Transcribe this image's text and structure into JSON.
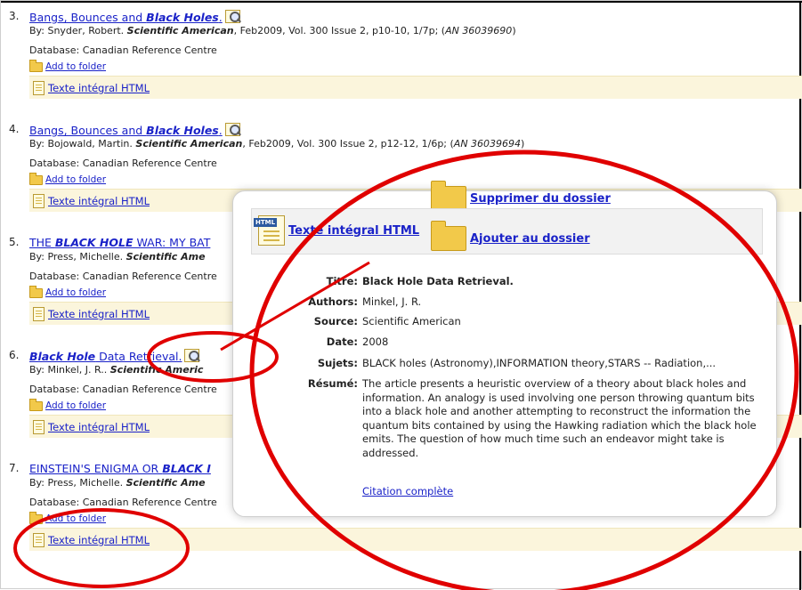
{
  "results": [
    {
      "number": "3.",
      "title_pre": "Bangs, Bounces and ",
      "title_em": "Black Holes",
      "title_post": ".",
      "byline_pre": "By: Snyder, Robert. ",
      "journal": "Scientific American",
      "byline_post": ", Feb2009, Vol. 300 Issue 2, p10-10, 1/7p; (",
      "an": "AN 36039690",
      "byline_end": ")",
      "database": "Database: Canadian Reference Centre",
      "folder_label": "Add to folder",
      "fulltext_label": "Texte intégral HTML"
    },
    {
      "number": "4.",
      "title_pre": "Bangs, Bounces and ",
      "title_em": "Black Holes",
      "title_post": ".",
      "byline_pre": "By: Bojowald, Martin. ",
      "journal": "Scientific American",
      "byline_post": ", Feb2009, Vol. 300 Issue 2, p12-12, 1/6p; (",
      "an": "AN 36039694",
      "byline_end": ")",
      "database": "Database: Canadian Reference Centre",
      "folder_label": "Add to folder",
      "fulltext_label": "Texte intégral HTML"
    },
    {
      "number": "5.",
      "title_pre": "THE ",
      "title_em": "BLACK HOLE",
      "title_post": " WAR: MY BAT",
      "byline_pre": "By: Press, Michelle. ",
      "journal": "Scientific Ame",
      "byline_post": "",
      "an": "",
      "byline_end": "",
      "database": "Database: Canadian Reference Centre",
      "folder_label": "Add to folder",
      "fulltext_label": "Texte intégral HTML"
    },
    {
      "number": "6.",
      "title_pre": "",
      "title_em": "Black Hole",
      "title_post": " Data Retrieval.",
      "byline_pre": "By: Minkel, J. R.. ",
      "journal": "Scientific Americ",
      "byline_post": "",
      "an": "",
      "byline_end": "",
      "database": "Database: Canadian Reference Centre",
      "folder_label": "Add to folder",
      "fulltext_label": "Texte intégral HTML"
    },
    {
      "number": "7.",
      "title_pre": "EINSTEIN'S ENIGMA OR ",
      "title_em": "BLACK I",
      "title_post": "",
      "byline_pre": "By: Press, Michelle. ",
      "journal": "Scientific Ame",
      "byline_post": "",
      "an": "",
      "byline_end": "",
      "database": "Database: Canadian Reference Centre",
      "folder_label": "Add to folder",
      "fulltext_label": "Texte intégral HTML"
    }
  ],
  "popup": {
    "remove_label": "Supprimer du dossier",
    "fulltext_label": "Texte intégral HTML",
    "add_label": "Ajouter au dossier",
    "html_badge": "HTML",
    "fields": [
      {
        "label": "Titre:",
        "value": "Black Hole Data Retrieval."
      },
      {
        "label": "Authors:",
        "value": "Minkel, J. R."
      },
      {
        "label": "Source:",
        "value": "Scientific American"
      },
      {
        "label": "Date:",
        "value": "2008"
      },
      {
        "label": "Sujets:",
        "value": "BLACK holes (Astronomy),INFORMATION theory,STARS -- Radiation,..."
      },
      {
        "label": "Résumé:",
        "value": "The article presents a heuristic overview of a theory about black holes and information. An analogy is used involving one person throwing quantum bits into a black hole and another attempting to reconstruct the information the quantum bits contained by using the Hawking radiation which the black hole emits. The question of how much time such an endeavor might take is addressed."
      }
    ],
    "citation_label": "Citation complète"
  },
  "colors": {
    "link": "#1a22c8",
    "annotation": "#e00000",
    "fulltext_bar": "#fbf5dc"
  }
}
